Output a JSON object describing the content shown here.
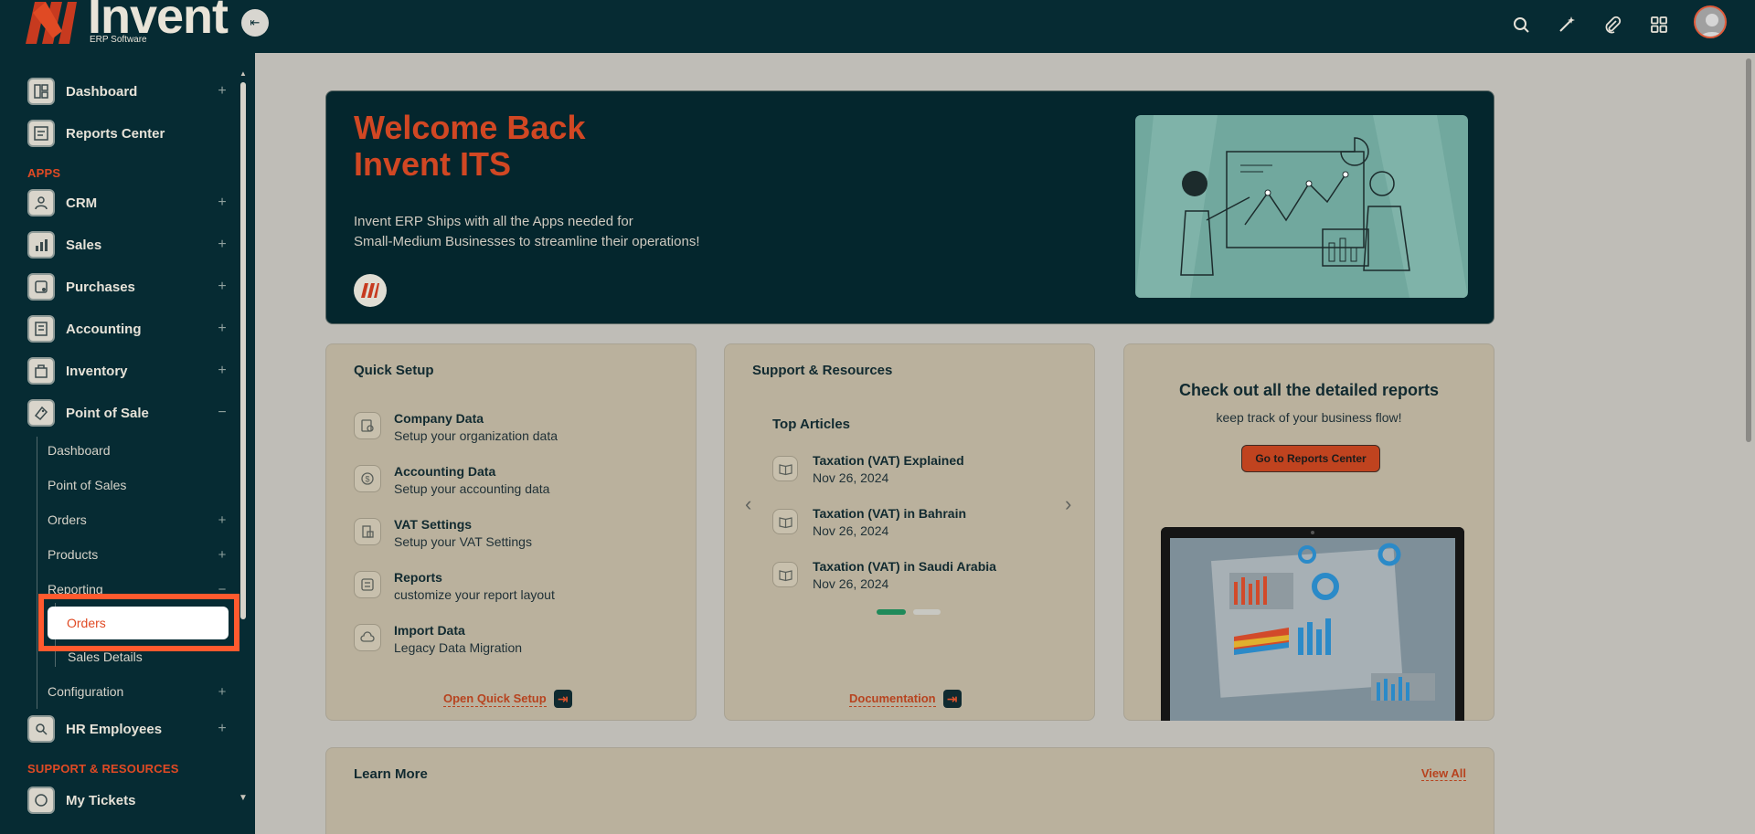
{
  "brand": {
    "name": "Invent",
    "subtitle": "ERP Software"
  },
  "sidebar": {
    "top_items": [
      {
        "label": "Dashboard",
        "icon": "dashboard-icon"
      },
      {
        "label": "Reports Center",
        "icon": "reports-icon"
      }
    ],
    "apps_title": "APPS",
    "apps": [
      {
        "label": "CRM",
        "icon": "crm-icon"
      },
      {
        "label": "Sales",
        "icon": "sales-icon"
      },
      {
        "label": "Purchases",
        "icon": "purchases-icon"
      },
      {
        "label": "Accounting",
        "icon": "accounting-icon"
      },
      {
        "label": "Inventory",
        "icon": "inventory-icon"
      },
      {
        "label": "Point of Sale",
        "icon": "pos-icon",
        "expanded": true
      }
    ],
    "pos_sub": [
      {
        "label": "Dashboard"
      },
      {
        "label": "Point of Sales"
      },
      {
        "label": "Orders"
      },
      {
        "label": "Products"
      },
      {
        "label": "Reporting"
      },
      {
        "label": "Orders",
        "active": true
      },
      {
        "label": "Sales Details"
      },
      {
        "label": "Configuration"
      }
    ],
    "hr": {
      "label": "HR Employees",
      "icon": "hr-icon"
    },
    "support_title": "SUPPORT & RESOURCES",
    "tickets": {
      "label": "My Tickets",
      "icon": "tickets-icon"
    }
  },
  "topbar": {
    "icons": [
      "search-icon",
      "magic-wand-icon",
      "paperclip-icon",
      "apps-grid-icon",
      "user-avatar"
    ]
  },
  "banner": {
    "title_line1": "Welcome Back",
    "title_line2": "Invent ITS",
    "text_line1": "Invent ERP Ships with all the Apps needed for",
    "text_line2": "Small-Medium Businesses to streamline their operations!"
  },
  "quick_setup": {
    "title": "Quick Setup",
    "items": [
      {
        "name": "Company Data",
        "desc": "Setup your organization data"
      },
      {
        "name": "Accounting Data",
        "desc": "Setup your accounting data"
      },
      {
        "name": "VAT Settings",
        "desc": "Setup your VAT Settings"
      },
      {
        "name": "Reports",
        "desc": "customize your report layout"
      },
      {
        "name": "Import Data",
        "desc": "Legacy Data Migration"
      }
    ],
    "link": "Open Quick Setup"
  },
  "support": {
    "title": "Support & Resources",
    "subtitle": "Top Articles",
    "articles": [
      {
        "title": "Taxation (VAT) Explained",
        "date": "Nov 26, 2024"
      },
      {
        "title": "Taxation (VAT) in Bahrain",
        "date": "Nov 26, 2024"
      },
      {
        "title": "Taxation (VAT) in Saudi Arabia",
        "date": "Nov 26, 2024"
      }
    ],
    "link": "Documentation"
  },
  "reports": {
    "title": "Check out all the detailed reports",
    "subtitle": "keep track of your business flow!",
    "button": "Go to Reports Center"
  },
  "learn_more": {
    "title": "Learn More",
    "link": "View All"
  },
  "colors": {
    "sidebar_bg": "#062b33",
    "accent": "#e04a24",
    "overlay_main": "#bfbdb7",
    "card_bg": "#bab19d"
  }
}
